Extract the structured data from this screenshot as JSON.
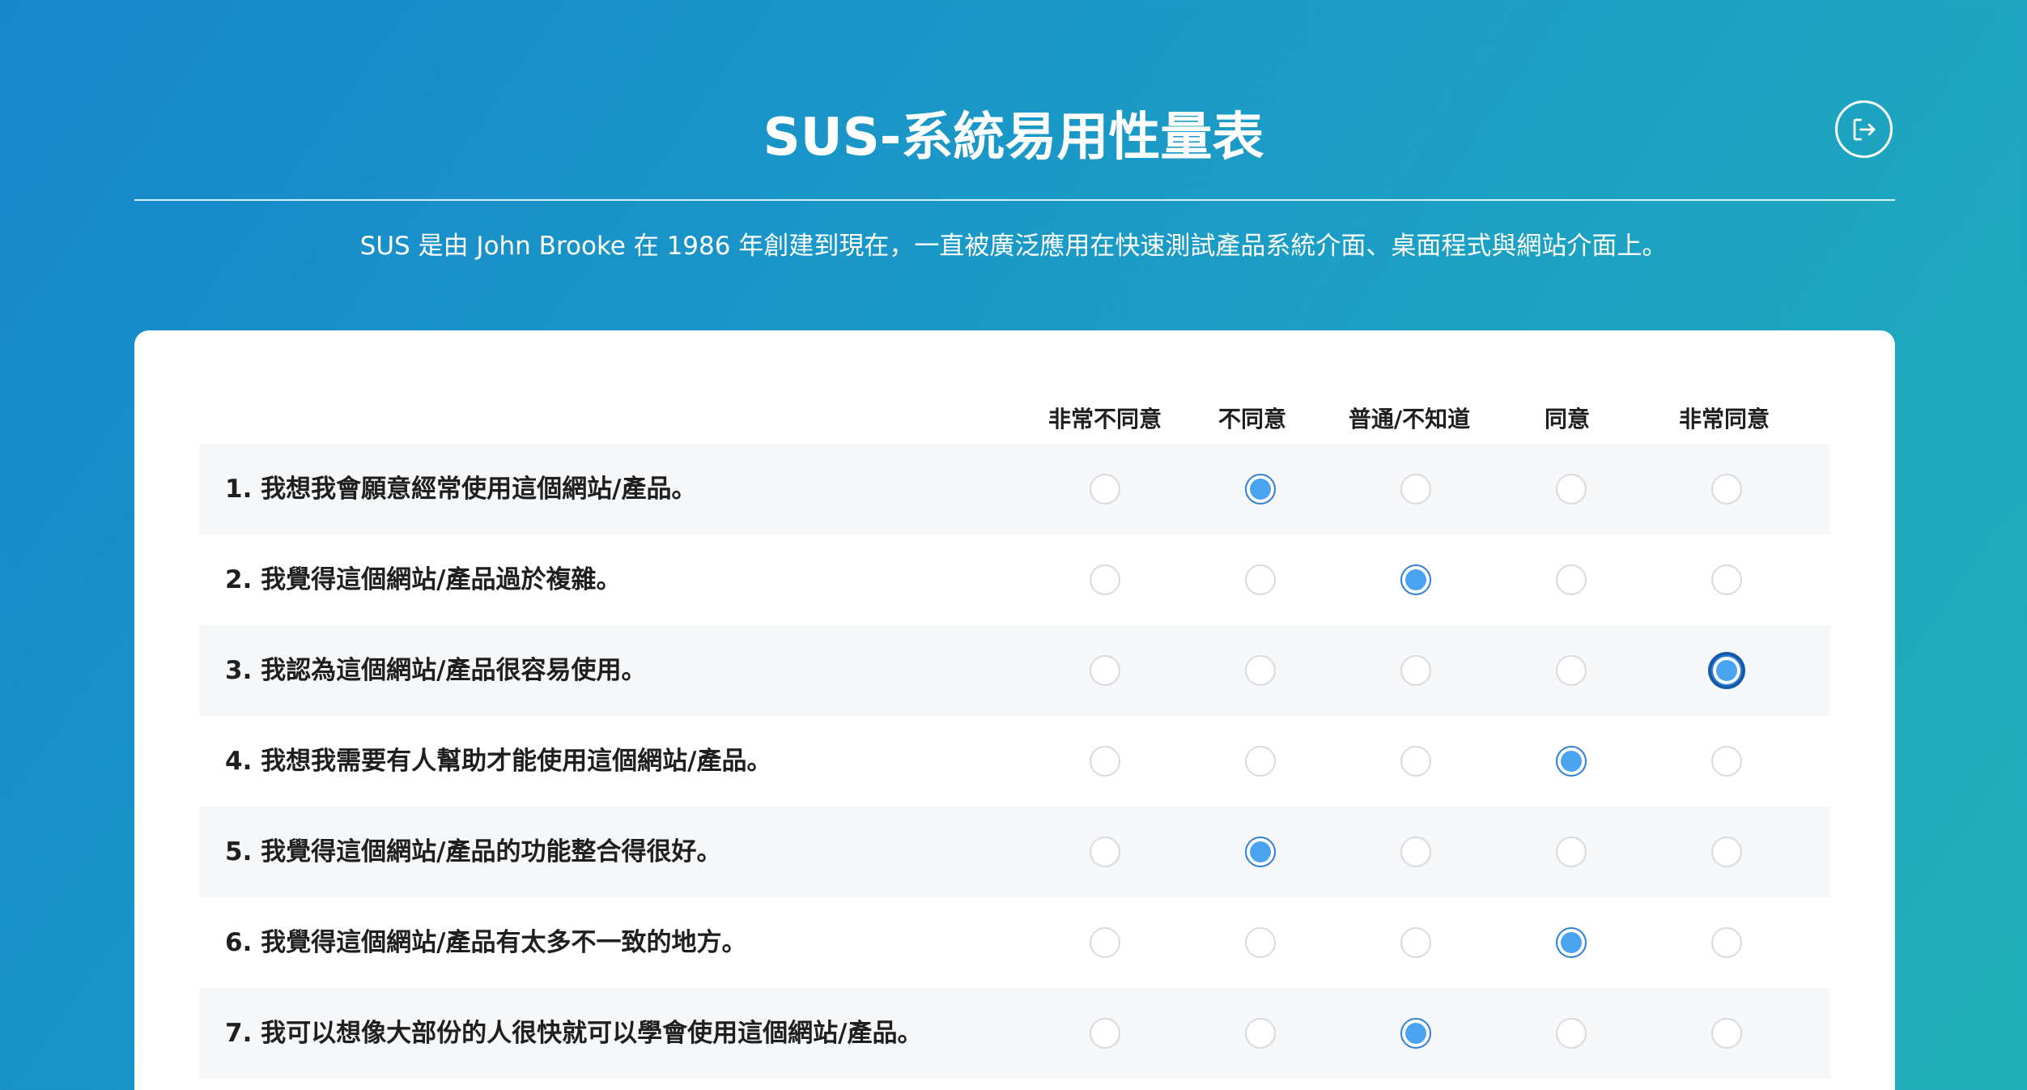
{
  "header": {
    "title": "SUS-系統易用性量表",
    "subtitle": "SUS 是由 John Brooke 在 1986 年創建到現在，一直被廣泛應用在快速測試產品系統介面、桌面程式與網站介面上。",
    "logout_icon": "logout-icon"
  },
  "survey": {
    "scale": [
      "非常不同意",
      "不同意",
      "普通/不知道",
      "同意",
      "非常同意"
    ],
    "questions": [
      {
        "text": "1. 我想我會願意經常使用這個網站/產品。",
        "selected": 1
      },
      {
        "text": "2. 我覺得這個網站/產品過於複雜。",
        "selected": 2
      },
      {
        "text": "3. 我認為這個網站/產品很容易使用。",
        "selected": 4
      },
      {
        "text": "4. 我想我需要有人幫助才能使用這個網站/產品。",
        "selected": 3
      },
      {
        "text": "5. 我覺得這個網站/產品的功能整合得很好。",
        "selected": 1
      },
      {
        "text": "6. 我覺得這個網站/產品有太多不一致的地方。",
        "selected": 3
      },
      {
        "text": "7. 我可以想像大部份的人很快就可以學會使用這個網站/產品。",
        "selected": 2
      }
    ],
    "focused_question": 2
  },
  "colors": {
    "accent": "#4aa3ef",
    "radio_border_checked": "#2e7fd6",
    "focus_ring": "#1559a8"
  }
}
